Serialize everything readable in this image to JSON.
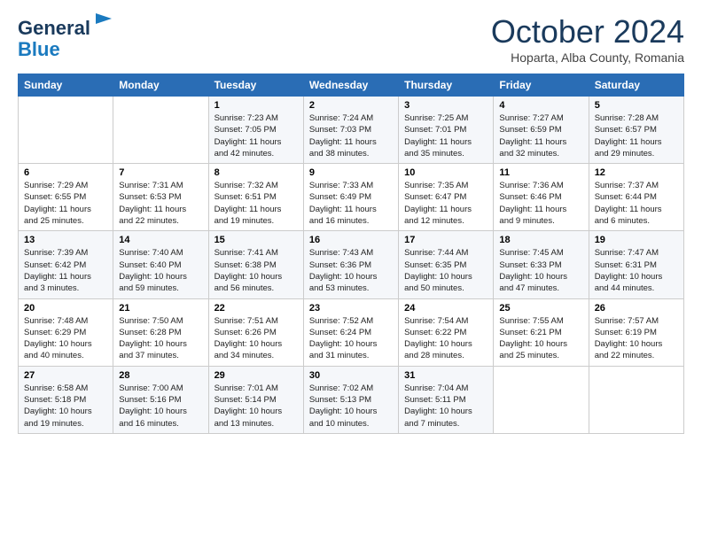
{
  "header": {
    "logo_general": "General",
    "logo_blue": "Blue",
    "month": "October 2024",
    "location": "Hoparta, Alba County, Romania"
  },
  "days_of_week": [
    "Sunday",
    "Monday",
    "Tuesday",
    "Wednesday",
    "Thursday",
    "Friday",
    "Saturday"
  ],
  "weeks": [
    [
      {
        "day": "",
        "info": ""
      },
      {
        "day": "",
        "info": ""
      },
      {
        "day": "1",
        "info": "Sunrise: 7:23 AM\nSunset: 7:05 PM\nDaylight: 11 hours and 42 minutes."
      },
      {
        "day": "2",
        "info": "Sunrise: 7:24 AM\nSunset: 7:03 PM\nDaylight: 11 hours and 38 minutes."
      },
      {
        "day": "3",
        "info": "Sunrise: 7:25 AM\nSunset: 7:01 PM\nDaylight: 11 hours and 35 minutes."
      },
      {
        "day": "4",
        "info": "Sunrise: 7:27 AM\nSunset: 6:59 PM\nDaylight: 11 hours and 32 minutes."
      },
      {
        "day": "5",
        "info": "Sunrise: 7:28 AM\nSunset: 6:57 PM\nDaylight: 11 hours and 29 minutes."
      }
    ],
    [
      {
        "day": "6",
        "info": "Sunrise: 7:29 AM\nSunset: 6:55 PM\nDaylight: 11 hours and 25 minutes."
      },
      {
        "day": "7",
        "info": "Sunrise: 7:31 AM\nSunset: 6:53 PM\nDaylight: 11 hours and 22 minutes."
      },
      {
        "day": "8",
        "info": "Sunrise: 7:32 AM\nSunset: 6:51 PM\nDaylight: 11 hours and 19 minutes."
      },
      {
        "day": "9",
        "info": "Sunrise: 7:33 AM\nSunset: 6:49 PM\nDaylight: 11 hours and 16 minutes."
      },
      {
        "day": "10",
        "info": "Sunrise: 7:35 AM\nSunset: 6:47 PM\nDaylight: 11 hours and 12 minutes."
      },
      {
        "day": "11",
        "info": "Sunrise: 7:36 AM\nSunset: 6:46 PM\nDaylight: 11 hours and 9 minutes."
      },
      {
        "day": "12",
        "info": "Sunrise: 7:37 AM\nSunset: 6:44 PM\nDaylight: 11 hours and 6 minutes."
      }
    ],
    [
      {
        "day": "13",
        "info": "Sunrise: 7:39 AM\nSunset: 6:42 PM\nDaylight: 11 hours and 3 minutes."
      },
      {
        "day": "14",
        "info": "Sunrise: 7:40 AM\nSunset: 6:40 PM\nDaylight: 10 hours and 59 minutes."
      },
      {
        "day": "15",
        "info": "Sunrise: 7:41 AM\nSunset: 6:38 PM\nDaylight: 10 hours and 56 minutes."
      },
      {
        "day": "16",
        "info": "Sunrise: 7:43 AM\nSunset: 6:36 PM\nDaylight: 10 hours and 53 minutes."
      },
      {
        "day": "17",
        "info": "Sunrise: 7:44 AM\nSunset: 6:35 PM\nDaylight: 10 hours and 50 minutes."
      },
      {
        "day": "18",
        "info": "Sunrise: 7:45 AM\nSunset: 6:33 PM\nDaylight: 10 hours and 47 minutes."
      },
      {
        "day": "19",
        "info": "Sunrise: 7:47 AM\nSunset: 6:31 PM\nDaylight: 10 hours and 44 minutes."
      }
    ],
    [
      {
        "day": "20",
        "info": "Sunrise: 7:48 AM\nSunset: 6:29 PM\nDaylight: 10 hours and 40 minutes."
      },
      {
        "day": "21",
        "info": "Sunrise: 7:50 AM\nSunset: 6:28 PM\nDaylight: 10 hours and 37 minutes."
      },
      {
        "day": "22",
        "info": "Sunrise: 7:51 AM\nSunset: 6:26 PM\nDaylight: 10 hours and 34 minutes."
      },
      {
        "day": "23",
        "info": "Sunrise: 7:52 AM\nSunset: 6:24 PM\nDaylight: 10 hours and 31 minutes."
      },
      {
        "day": "24",
        "info": "Sunrise: 7:54 AM\nSunset: 6:22 PM\nDaylight: 10 hours and 28 minutes."
      },
      {
        "day": "25",
        "info": "Sunrise: 7:55 AM\nSunset: 6:21 PM\nDaylight: 10 hours and 25 minutes."
      },
      {
        "day": "26",
        "info": "Sunrise: 7:57 AM\nSunset: 6:19 PM\nDaylight: 10 hours and 22 minutes."
      }
    ],
    [
      {
        "day": "27",
        "info": "Sunrise: 6:58 AM\nSunset: 5:18 PM\nDaylight: 10 hours and 19 minutes."
      },
      {
        "day": "28",
        "info": "Sunrise: 7:00 AM\nSunset: 5:16 PM\nDaylight: 10 hours and 16 minutes."
      },
      {
        "day": "29",
        "info": "Sunrise: 7:01 AM\nSunset: 5:14 PM\nDaylight: 10 hours and 13 minutes."
      },
      {
        "day": "30",
        "info": "Sunrise: 7:02 AM\nSunset: 5:13 PM\nDaylight: 10 hours and 10 minutes."
      },
      {
        "day": "31",
        "info": "Sunrise: 7:04 AM\nSunset: 5:11 PM\nDaylight: 10 hours and 7 minutes."
      },
      {
        "day": "",
        "info": ""
      },
      {
        "day": "",
        "info": ""
      }
    ]
  ]
}
